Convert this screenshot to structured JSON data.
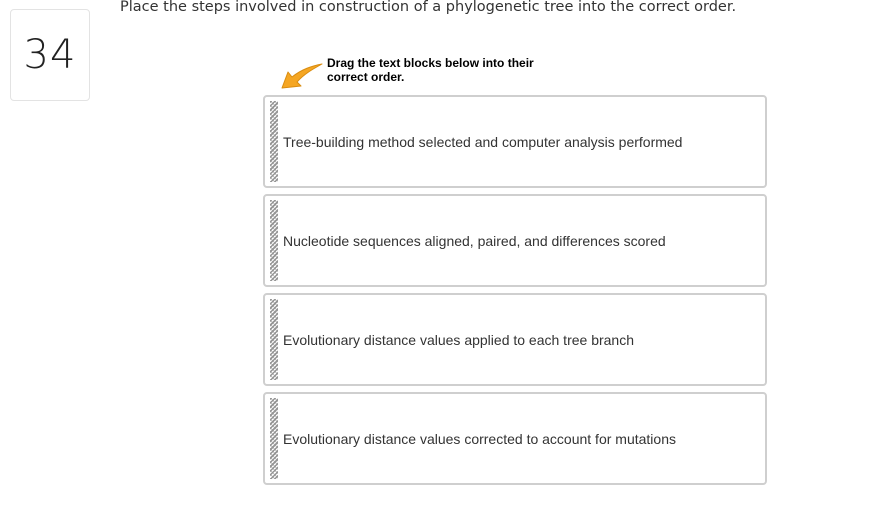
{
  "question": {
    "number": "34",
    "prompt": "Place the steps involved in construction of a phylogenetic tree into the correct order."
  },
  "hint": {
    "text": "Drag the text blocks below into their correct order.",
    "icon": "arrow-pointer-icon",
    "arrow_color": "#F5A623"
  },
  "steps": [
    {
      "label": "Tree-building method selected and computer analysis performed"
    },
    {
      "label": "Nucleotide sequences aligned, paired, and differences scored"
    },
    {
      "label": "Evolutionary distance values applied to each tree branch"
    },
    {
      "label": "Evolutionary distance values corrected to account for mutations"
    }
  ],
  "colors": {
    "border": "#CFCFCF",
    "text": "#333333"
  }
}
